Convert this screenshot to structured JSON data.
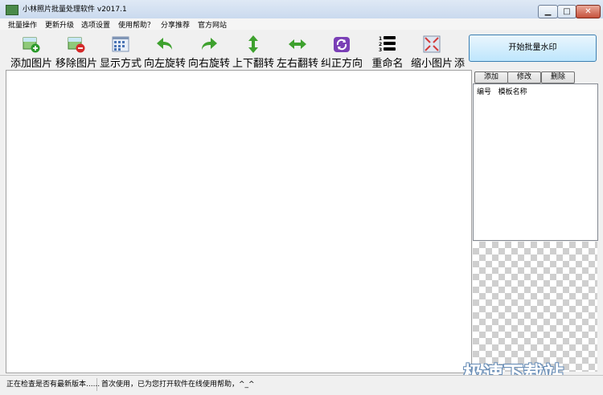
{
  "window": {
    "title": "小林照片批量处理软件 v2017.1",
    "min": "▁",
    "max": "□",
    "close": "✕"
  },
  "menu": [
    "批量操作",
    "更新升级",
    "选项设置",
    "使用帮助？",
    "分享推荐",
    "官方网站"
  ],
  "toolbar": [
    {
      "label": "添加图片",
      "icon": "add-image-icon"
    },
    {
      "label": "移除图片",
      "icon": "remove-image-icon"
    },
    {
      "label": "显示方式",
      "icon": "grid-view-icon"
    },
    {
      "label": "向左旋转",
      "icon": "rotate-left-icon"
    },
    {
      "label": "向右旋转",
      "icon": "rotate-right-icon"
    },
    {
      "label": "上下翻转",
      "icon": "flip-vertical-icon"
    },
    {
      "label": "左右翻转",
      "icon": "flip-horizontal-icon"
    },
    {
      "label": "纠正方向",
      "icon": "correct-orientation-icon"
    },
    {
      "label": "重命名",
      "icon": "numbered-list-icon"
    },
    {
      "label": "缩小图片",
      "icon": "shrink-image-icon"
    },
    {
      "label": "添",
      "icon": ""
    }
  ],
  "side": {
    "start_button": "开始批量水印",
    "add": "添加",
    "edit": "修改",
    "delete": "删除",
    "columns": [
      "编号",
      "模板名称"
    ]
  },
  "status": [
    "正在检查是否有最新版本......",
    "首次使用，已为您打开软件在线使用帮助，^_^"
  ],
  "watermark": "极速下载站"
}
